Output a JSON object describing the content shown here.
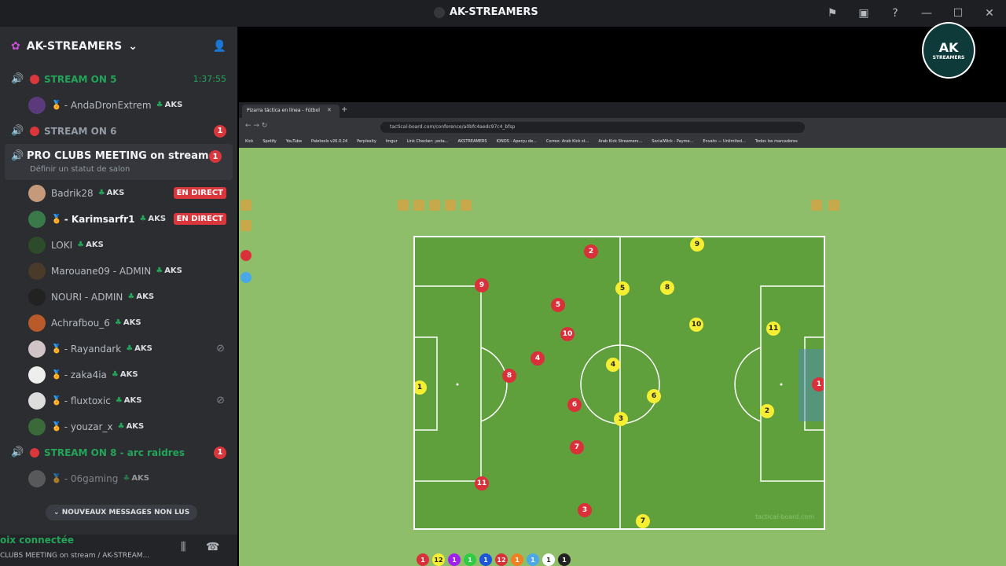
{
  "window": {
    "title": "AK-STREAMERS"
  },
  "server": {
    "name": "AK-STREAMERS"
  },
  "channels": [
    {
      "name": "STREAM ON 5",
      "time": "1:37:55"
    },
    {
      "name": "STREAM ON 6",
      "badge": "1"
    },
    {
      "name": "PRO CLUBS MEETING on stream",
      "badge": "1",
      "status": "Définir un statut de salon"
    },
    {
      "name": "STREAM ON 8 - arc raidres",
      "badge": "1"
    }
  ],
  "stream5_user": {
    "name": "- AndaDronExtrem",
    "tag": "AKS"
  },
  "users": [
    {
      "name": "Badrik28",
      "tag": "AKS",
      "live": "EN DIRECT"
    },
    {
      "name": "- Karimsarfr1",
      "tag": "AKS",
      "live": "EN DIRECT"
    },
    {
      "name": "LOKI",
      "tag": "AKS"
    },
    {
      "name": "Marouane09 - ADMIN",
      "tag": "AKS"
    },
    {
      "name": "NOURI - ADMIN",
      "tag": "AKS"
    },
    {
      "name": "Achrafbou_6",
      "tag": "AKS"
    },
    {
      "name": "- Rayandark",
      "tag": "AKS"
    },
    {
      "name": "- zaka4ia",
      "tag": "AKS"
    },
    {
      "name": "- fluxtoxic",
      "tag": "AKS"
    },
    {
      "name": "- youzar_x",
      "tag": "AKS"
    }
  ],
  "stream8_user": {
    "name": "- 06gaming",
    "tag": "AKS"
  },
  "unread": "NOUVEAUX MESSAGES NON LUS",
  "voice": {
    "status": "oix connectée",
    "channel": "CLUBS MEETING on stream / AK-STREAM..."
  },
  "logo": {
    "text": "AK",
    "sub": "STREAMERS"
  },
  "browser": {
    "tab": "Pizarra táctica en línea - Fútbol",
    "url": "tactical-board.com/conference/a0bfc4aedc97c4_bfsp",
    "bookmarks": [
      "Kick",
      "Spotify",
      "YouTube",
      "Paletools v26.0.24",
      "Perplexity",
      "Imgur",
      "Link Checker: ¡esta...",
      "AKSTREAMERS",
      "IONOS - Aperçu de...",
      "Correo: Arab Kick st...",
      "Arab Kick Streamers...",
      "SocialWick - Payme...",
      "Envato — Unlimited...",
      "Todos los marcadores"
    ]
  },
  "board": {
    "watermark": "tactical-board.com",
    "red": [
      "2",
      "9",
      "5",
      "10",
      "4",
      "8",
      "6",
      "7",
      "3",
      "11",
      "1"
    ],
    "yellow": [
      "9",
      "5",
      "8",
      "10",
      "11",
      "4",
      "6",
      "3",
      "1",
      "2",
      "7"
    ],
    "tokens": [
      "1",
      "12",
      "1",
      "1",
      "1",
      "12",
      "1",
      "1",
      "1",
      "1"
    ]
  }
}
